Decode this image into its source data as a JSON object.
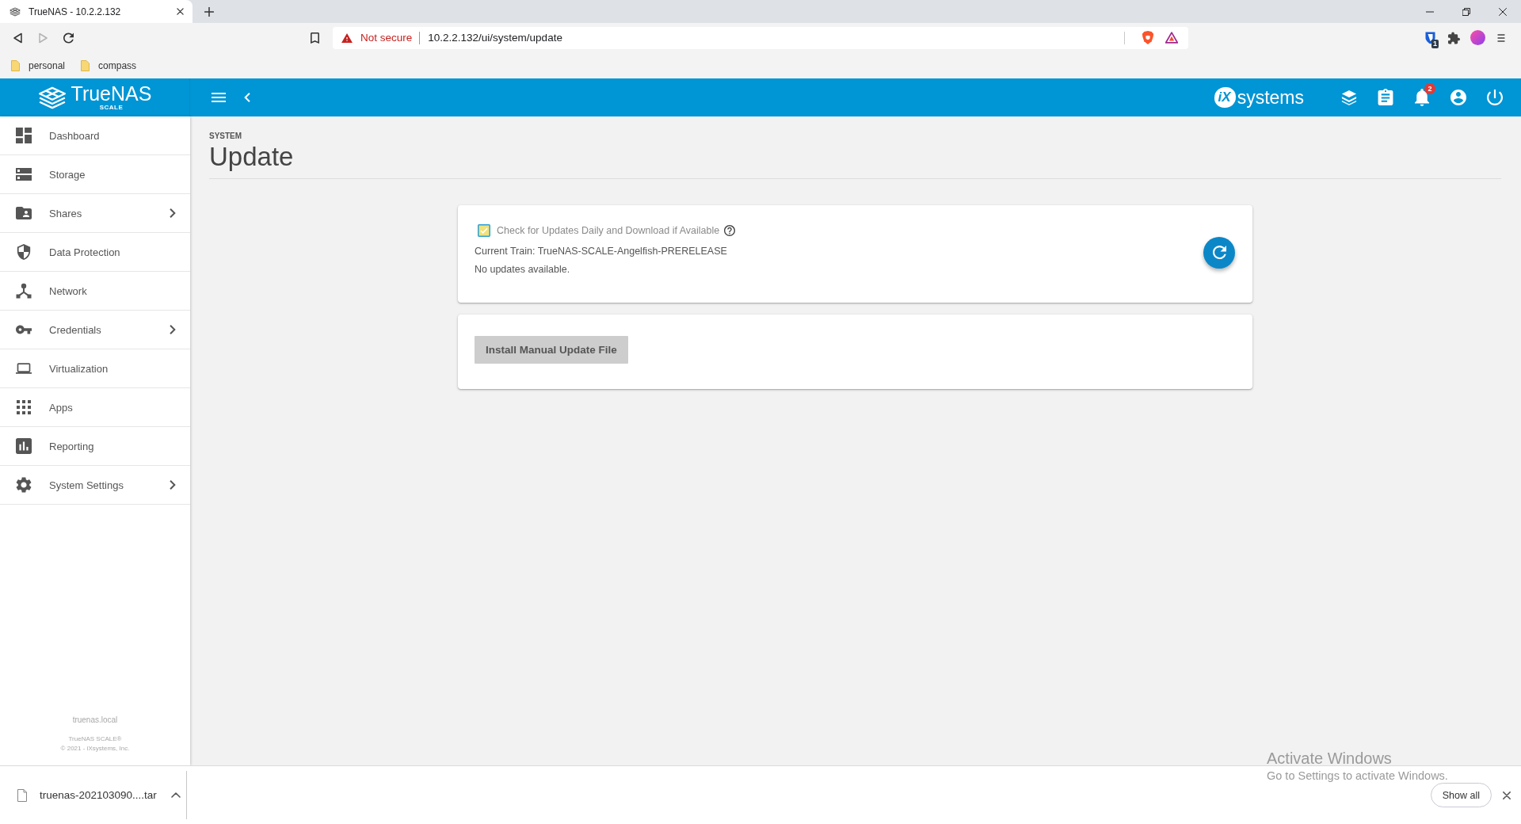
{
  "browser": {
    "tab": {
      "title": "TrueNAS - 10.2.2.132",
      "selected": true
    },
    "nav_buttons": [
      {
        "kind": "back",
        "disabled": false
      },
      {
        "kind": "forward",
        "disabled": true
      },
      {
        "kind": "reload",
        "disabled": false
      }
    ],
    "security_label": "Not secure",
    "url": "10.2.2.132/ui/system/update",
    "extension_badge": "1",
    "bookmarks": [
      {
        "label": "personal"
      },
      {
        "label": "compass"
      }
    ]
  },
  "header": {
    "brand": "TrueNAS",
    "edition": "SCALE",
    "vendor_mark": "iX",
    "vendor_name": "systems",
    "notification_count": "2"
  },
  "sidebar": {
    "items": [
      {
        "label": "Dashboard",
        "expandable": false,
        "selected": false
      },
      {
        "label": "Storage",
        "expandable": false,
        "selected": false
      },
      {
        "label": "Shares",
        "expandable": true,
        "selected": false
      },
      {
        "label": "Data Protection",
        "expandable": false,
        "selected": false
      },
      {
        "label": "Network",
        "expandable": false,
        "selected": false
      },
      {
        "label": "Credentials",
        "expandable": true,
        "selected": false
      },
      {
        "label": "Virtualization",
        "expandable": false,
        "selected": false
      },
      {
        "label": "Apps",
        "expandable": false,
        "selected": false
      },
      {
        "label": "Reporting",
        "expandable": false,
        "selected": false
      },
      {
        "label": "System Settings",
        "expandable": true,
        "selected": false
      }
    ],
    "hostname": "truenas.local",
    "product": "TrueNAS SCALE®",
    "copyright": "© 2021 - iXsystems, Inc."
  },
  "page": {
    "breadcrumb": "SYSTEM",
    "title": "Update"
  },
  "update_card": {
    "auto_check": {
      "label": "Check for Updates Daily and Download if Available",
      "checked": true
    },
    "current_train": "Current Train: TrueNAS-SCALE-Angelfish-PRERELEASE",
    "status": "No updates available."
  },
  "manual_card": {
    "button": "Install Manual Update File"
  },
  "download_bar": {
    "filename": "truenas-202103090....tar",
    "show_all": "Show all"
  },
  "activation_notice": {
    "title": "Activate Windows",
    "text": "Go to Settings to activate Windows."
  }
}
